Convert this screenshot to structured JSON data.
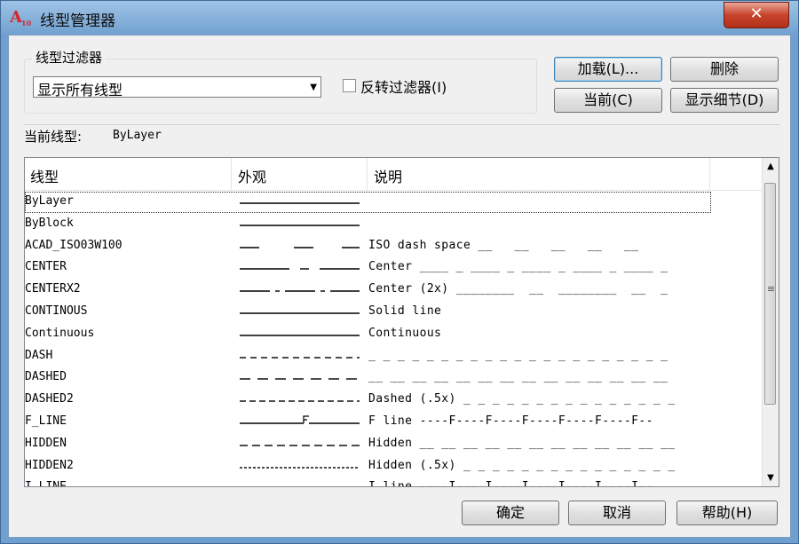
{
  "window": {
    "title": "线型管理器",
    "app_icon_text": "A",
    "app_icon_sub": "10",
    "close_glyph": "✕"
  },
  "filter": {
    "group_label": "线型过滤器",
    "selected": "显示所有线型",
    "invert_label": "反转过滤器(I)",
    "invert_checked": false
  },
  "buttons": {
    "load": "加载(L)...",
    "delete": "删除",
    "current": "当前(C)",
    "details": "显示细节(D)",
    "ok": "确定",
    "cancel": "取消",
    "help": "帮助(H)"
  },
  "current_linetype": {
    "label": "当前线型:",
    "value": "ByLayer"
  },
  "table": {
    "columns": [
      "线型",
      "外观",
      "说明"
    ],
    "rows": [
      {
        "name": "ByLayer",
        "look": "solid",
        "desc": ""
      },
      {
        "name": "ByBlock",
        "look": "solid",
        "desc": ""
      },
      {
        "name": "ACAD_ISO03W100",
        "look": "iso03",
        "desc": "ISO dash space __   __   __   __   __"
      },
      {
        "name": "CENTER",
        "look": "center",
        "desc": "Center ____ _ ____ _ ____ _ ____ _ ____ _"
      },
      {
        "name": "CENTERX2",
        "look": "center2",
        "desc": "Center (2x) ________  __  ________  __  _"
      },
      {
        "name": "CONTINOUS",
        "look": "solid",
        "desc": "Solid line"
      },
      {
        "name": "Continuous",
        "look": "solid",
        "desc": "Continuous"
      },
      {
        "name": "DASH",
        "look": "dash",
        "desc": "_ _ _ _ _ _ _ _ _ _ _ _ _ _ _ _ _ _ _ _ _"
      },
      {
        "name": "DASHED",
        "look": "dashed",
        "desc": "__ __ __ __ __ __ __ __ __ __ __ __ __ __"
      },
      {
        "name": "DASHED2",
        "look": "dashed2",
        "desc": "Dashed (.5x) _ _ _ _ _ _ _ _ _ _ _ _ _ _ _"
      },
      {
        "name": "F_LINE",
        "look": "fline",
        "desc": "F line ----F----F----F----F----F----F--"
      },
      {
        "name": "HIDDEN",
        "look": "hidden",
        "desc": "Hidden __ __ __ __ __ __ __ __ __ __ __ __"
      },
      {
        "name": "HIDDEN2",
        "look": "hidden2",
        "desc": "Hidden (.5x) _ _ _ _ _ _ _ _ _ _ _ _ _ _ _"
      },
      {
        "name": "I_LINE",
        "look": "iline",
        "desc": "I line ----I----I----I----I----I----I--"
      }
    ],
    "selected_index": 0
  },
  "scrollbar": {
    "up": "▲",
    "down": "▼",
    "grip": "≡"
  }
}
